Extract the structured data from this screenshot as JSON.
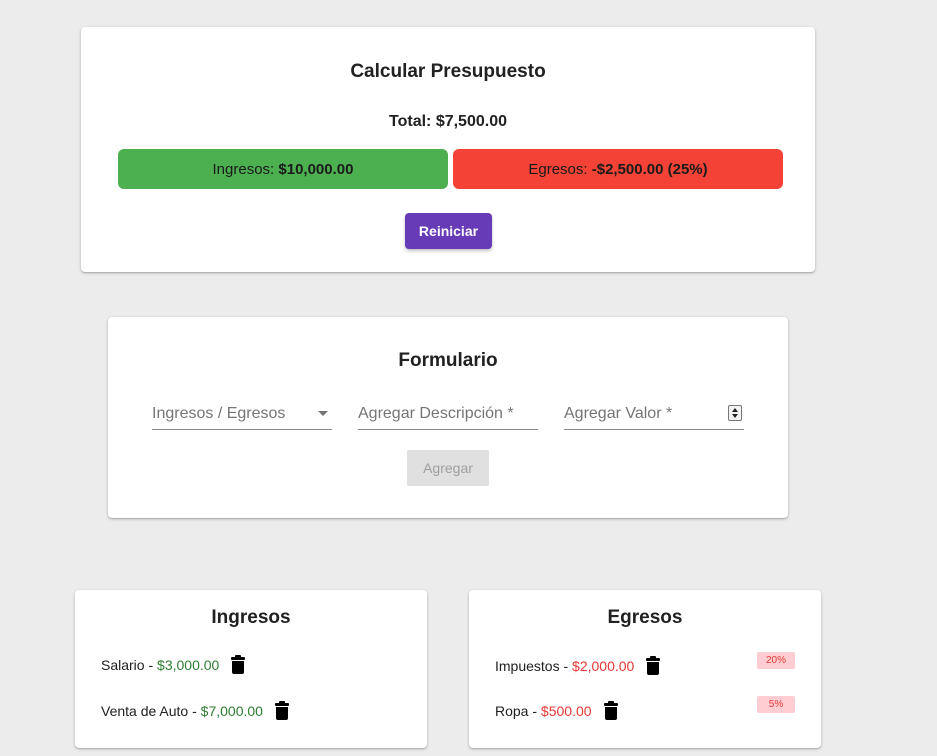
{
  "budget": {
    "title": "Calcular Presupuesto",
    "total_label": "Total:",
    "total_value": "$7,500.00",
    "income_label": "Ingresos:",
    "income_value": "$10,000.00",
    "expense_label": "Egresos:",
    "expense_value": "-$2,500.00 (25%)",
    "reset_label": "Reiniciar",
    "colors": {
      "income": "#4caf50",
      "expense": "#f44336",
      "accent": "#673ab7"
    }
  },
  "form": {
    "title": "Formulario",
    "type_placeholder": "Ingresos / Egresos",
    "description_placeholder": "Agregar Descripción *",
    "value_placeholder": "Agregar Valor *",
    "add_label": "Agregar"
  },
  "income_list": {
    "title": "Ingresos",
    "items": [
      {
        "name": "Salario",
        "amount": "$3,000.00"
      },
      {
        "name": "Venta de Auto",
        "amount": "$7,000.00"
      }
    ]
  },
  "expense_list": {
    "title": "Egresos",
    "items": [
      {
        "name": "Impuestos",
        "amount": "$2,000.00",
        "percent": "20%"
      },
      {
        "name": "Ropa",
        "amount": "$500.00",
        "percent": "5%"
      }
    ]
  },
  "icons": {
    "delete": "trash-icon",
    "dropdown": "chevron-down-icon",
    "stepper": "number-stepper-icon"
  }
}
